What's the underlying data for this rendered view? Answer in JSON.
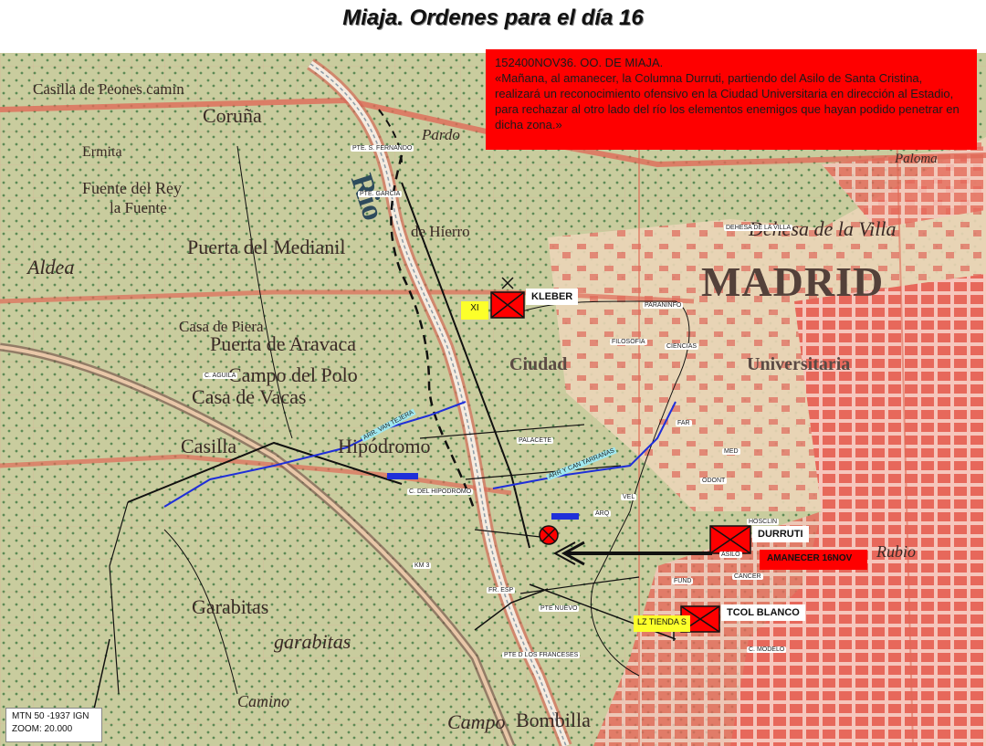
{
  "title": "Miaja. Ordenes para el día 16",
  "order": {
    "header": "152400NOV36. OO. DE MIAJA.",
    "text": "«Mañana, al amanecer, la Columna Durruti, partiendo del Asilo de Santa Cristina, realizará un reconocimiento ofensivo en la Ciudad Universitaria en dirección al Estadio, para rechazar al otro lado del río los elementos enemigos que hayan podido penetrar en dicha zona.»"
  },
  "units": {
    "kleber": "KLEBER",
    "durruti": "DURRUTI",
    "tcol_blanco": "TCOL BLANCO",
    "xi_tag": "XI",
    "lz_tag": "LZ TIENDA S",
    "amanecer_tag": "AMANECER 16NOV"
  },
  "legend": {
    "line1": "MTN 50 -1937 IGN",
    "line2": "ZOOM: 20.000"
  },
  "map_labels": {
    "madrid": "MADRID",
    "ciudad": "Ciudad",
    "universitaria": "Universitaria",
    "dehesa": "Dehesa de la Villa",
    "coruna": "Coruña",
    "rio": "Rio",
    "casilla_peones": "Casilla de Peones camin",
    "ermita": "Ermita",
    "fuente_rey": "Fuente del Rey",
    "la_fuente": "la Fuente",
    "puerta_medianil": "Puerta del Medianil",
    "puerta_aravaca": "Puerta de Aravaca",
    "campo_polo": "Campo del Polo",
    "casa_vacas": "Casa de Vacas",
    "casilla": "Casilla",
    "hipodromo": "Hipódromo",
    "garabitas": "Garabitas",
    "la_garabitas": "garabitas",
    "bombilla": "Bombilla",
    "campo": "Campo",
    "pardo": "Pardo",
    "rubio": "Rubio",
    "paloma": "Paloma",
    "camino": "Camino",
    "hierro": "de Hierro",
    "casa_piera": "Casa de Piera",
    "aldea": "Aldea"
  },
  "place_tags": {
    "pte_fernando": "PTE. S. FERNANDO",
    "pte_garcia": "PTE. GARCIA",
    "dehesa_villa": "DEHESA DE LA VILLA",
    "paraninfo": "PARANINFO",
    "filosofia": "FILOSOFIA",
    "ciencias": "CIENCIAS",
    "c_aguila": "C. AGUILA",
    "far": "FAR",
    "palacete": "PALACETE",
    "med": "MED",
    "odont": "ODONT",
    "vel": "VEL",
    "arq": "ARQ",
    "hospital": "HOSCLIN",
    "asilo": "ASILO",
    "fund": "FUND",
    "cancer": "CANCER",
    "c_hipodromo": "C. DEL HIPODROMO",
    "fr_esp": "FR. ESP",
    "pte_nuevo": "PTE NUEVO",
    "pte_franceses": "PTE D LOS FRANCESES",
    "c_modelo": "C. MODELO",
    "k3": "KM 3",
    "arr_cantarranas": "ARR Y CAN TARRANAS",
    "arr_tejera": "ARR. VAN TEJERA"
  },
  "colors": {
    "order_bg": "#fe0000",
    "unit_symbol": "#fe0000",
    "stream": "#1f2fd9",
    "yellow": "#fcff2a",
    "water": "#ffffff"
  }
}
